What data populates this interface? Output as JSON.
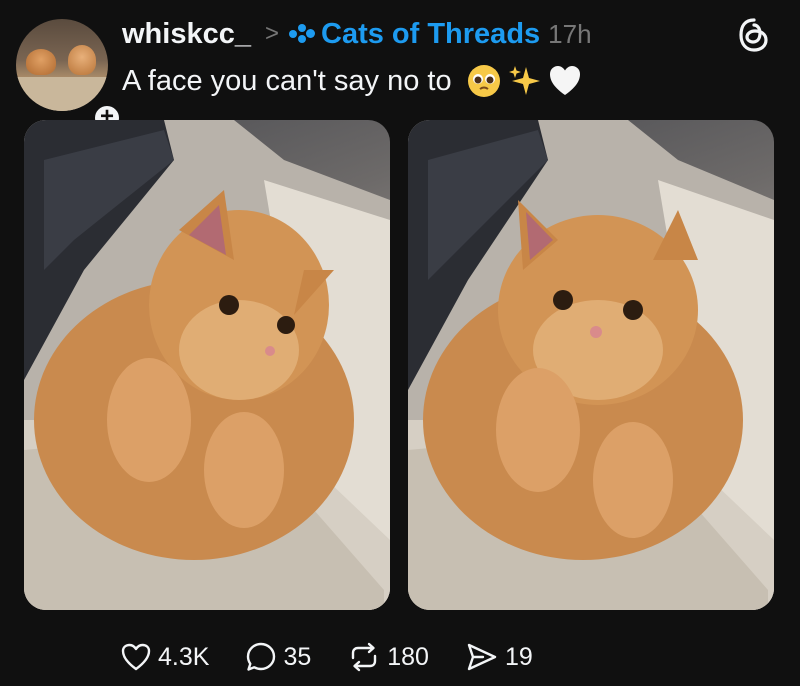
{
  "post": {
    "username": "whiskcc_",
    "separator": ">",
    "community": "Cats of Threads",
    "time": "17h",
    "caption": "A face you can't say no to",
    "follow_badge": "+"
  },
  "icons": {
    "community": "community-dots-icon",
    "app": "threads-logo-icon",
    "caption_emojis": [
      "pleading-face-emoji",
      "sparkles-emoji",
      "white-heart-emoji"
    ]
  },
  "stats": {
    "likes": "4.3K",
    "replies": "35",
    "reposts": "180",
    "shares": "19"
  },
  "colors": {
    "background": "#101010",
    "text": "#f3f5f7",
    "accent": "#1d9bf0",
    "muted": "#777777"
  }
}
